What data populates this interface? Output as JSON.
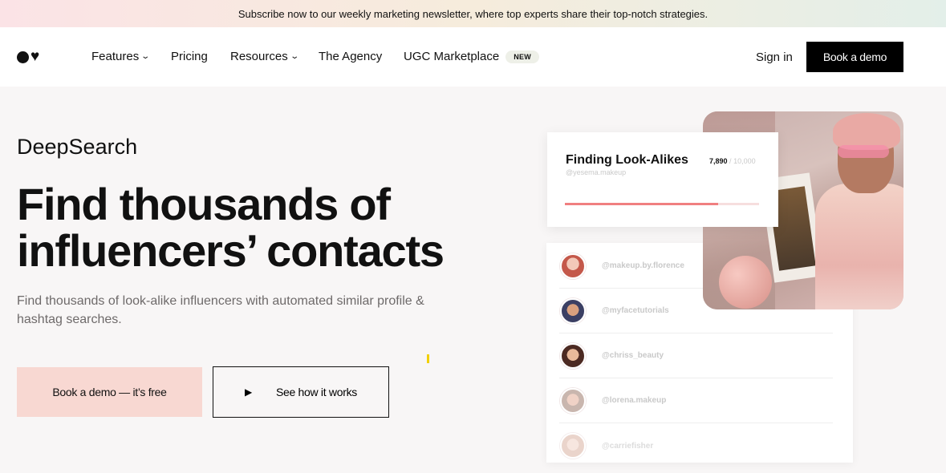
{
  "banner": {
    "text": "Subscribe now to our weekly marketing newsletter, where top experts share their top-notch strategies."
  },
  "nav": {
    "logo_icon": "heart-logo-icon",
    "items": [
      {
        "label": "Features",
        "has_dropdown": true
      },
      {
        "label": "Pricing",
        "has_dropdown": false
      },
      {
        "label": "Resources",
        "has_dropdown": true
      },
      {
        "label": "The Agency",
        "has_dropdown": false
      },
      {
        "label": "UGC Marketplace",
        "has_dropdown": false,
        "badge": "NEW"
      }
    ],
    "sign_in": "Sign in",
    "book_demo": "Book a demo"
  },
  "hero": {
    "eyebrow": "DeepSearch",
    "headline": "Find thousands of influencers’ contacts",
    "subtitle": "Find thousands of look-alike influencers with automated similar profile & hashtag searches.",
    "cta_primary": "Book a demo — it’s free",
    "cta_secondary": "See how it works",
    "cta_secondary_icon": "play-icon"
  },
  "metric_card": {
    "title": "Finding Look-Alikes",
    "handle": "@yesema.makeup",
    "count": "7,890",
    "separator": "/",
    "total": "10,000",
    "progress": 0.789
  },
  "influencers": [
    {
      "handle": "@makeup.by.florence"
    },
    {
      "handle": "@myfacetutorials"
    },
    {
      "handle": "@chriss_beauty"
    },
    {
      "handle": "@lorena.makeup"
    },
    {
      "handle": "@carriefisher"
    }
  ],
  "colors": {
    "accent_pink": "#f8d8d2",
    "progress": "#f07f80",
    "black": "#000000"
  }
}
